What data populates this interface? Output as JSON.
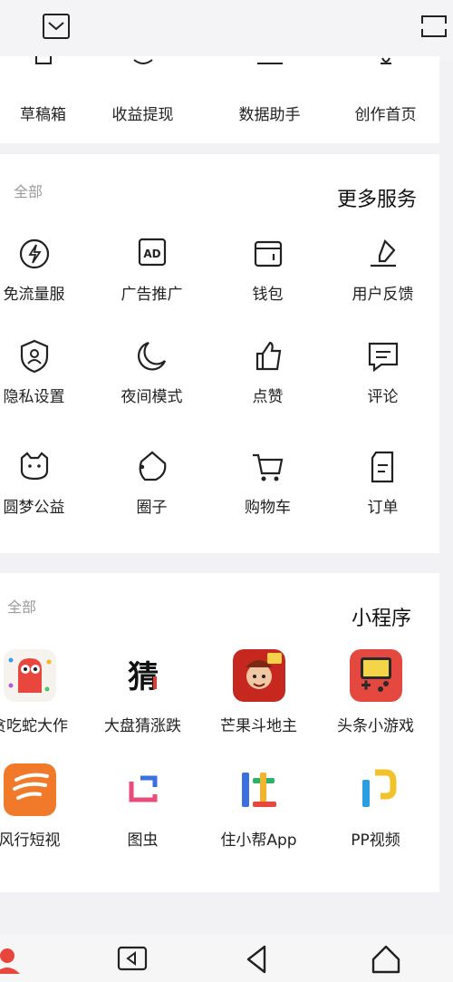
{
  "top_row": [
    {
      "label": "草稿箱",
      "icon": "draft-icon"
    },
    {
      "label": "收益提现",
      "icon": "earnings-icon"
    },
    {
      "label": "数据助手",
      "icon": "data-icon"
    },
    {
      "label": "创作首页",
      "icon": "creator-home-icon"
    }
  ],
  "more_services": {
    "title": "更多服务",
    "all_label": "全部",
    "items": [
      {
        "label": "免流量服",
        "icon": "lightning-icon"
      },
      {
        "label": "广告推广",
        "icon": "ad-icon"
      },
      {
        "label": "钱包",
        "icon": "wallet-icon"
      },
      {
        "label": "用户反馈",
        "icon": "feedback-icon"
      },
      {
        "label": "隐私设置",
        "icon": "privacy-shield-icon"
      },
      {
        "label": "夜间模式",
        "icon": "moon-icon"
      },
      {
        "label": "点赞",
        "icon": "thumbs-up-icon"
      },
      {
        "label": "评论",
        "icon": "comment-icon"
      },
      {
        "label": "圆梦公益",
        "icon": "charity-cat-icon"
      },
      {
        "label": "圈子",
        "icon": "circle-icon"
      },
      {
        "label": "购物车",
        "icon": "cart-icon"
      },
      {
        "label": "订单",
        "icon": "order-icon"
      }
    ]
  },
  "mini_programs": {
    "title": "小程序",
    "all_label": "全部",
    "items": [
      {
        "label": "贪吃蛇大作",
        "icon": "snake-game-app-icon"
      },
      {
        "label": "大盘猜涨跌",
        "icon": "stock-guess-app-icon"
      },
      {
        "label": "芒果斗地主",
        "icon": "landlord-game-app-icon"
      },
      {
        "label": "头条小游戏",
        "icon": "toutiao-games-app-icon"
      },
      {
        "label": "风行短视",
        "icon": "funshion-app-icon"
      },
      {
        "label": "图虫",
        "icon": "tuchong-app-icon"
      },
      {
        "label": "住小帮App",
        "icon": "zhuxiaobang-app-icon"
      },
      {
        "label": "PP视频",
        "icon": "pp-video-app-icon"
      }
    ]
  },
  "nav": {
    "icons": [
      "profile-icon",
      "back-square-icon",
      "back-triangle-icon",
      "home-icon"
    ]
  }
}
